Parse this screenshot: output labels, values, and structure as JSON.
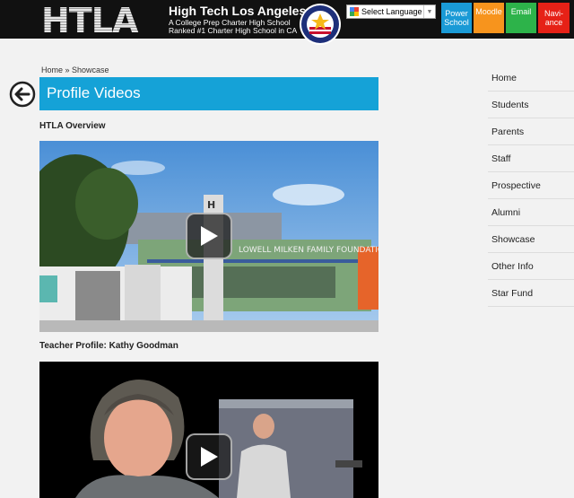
{
  "header": {
    "logo_text": "HTLA",
    "school_name": "High Tech Los Angeles",
    "tagline_line1": "A College Prep Charter High School",
    "tagline_line2": "Ranked #1 Charter High School in CA",
    "language_label": "Select Language",
    "buttons": [
      {
        "line1": "Power",
        "line2": "School",
        "color": "#1a9ad6"
      },
      {
        "line1": "Moodle",
        "line2": "",
        "color": "#f7941d"
      },
      {
        "line1": "Email",
        "line2": "",
        "color": "#2db34a"
      },
      {
        "line1": "Navi-",
        "line2": "ance",
        "color": "#e62117"
      }
    ]
  },
  "breadcrumb": "Home » Showcase",
  "page_title": "Profile Videos",
  "videos": [
    {
      "label": "HTLA Overview",
      "sign_text": "LOWELL MILKEN FAMILY FOUNDATION"
    },
    {
      "label": "Teacher Profile: Kathy Goodman"
    }
  ],
  "sidebar": {
    "items": [
      "Home",
      "Students",
      "Parents",
      "Staff",
      "Prospective",
      "Alumni",
      "Showcase",
      "Other Info",
      "Star Fund"
    ]
  },
  "colors": {
    "accent": "#15a2d7",
    "header_bg": "#111111"
  }
}
